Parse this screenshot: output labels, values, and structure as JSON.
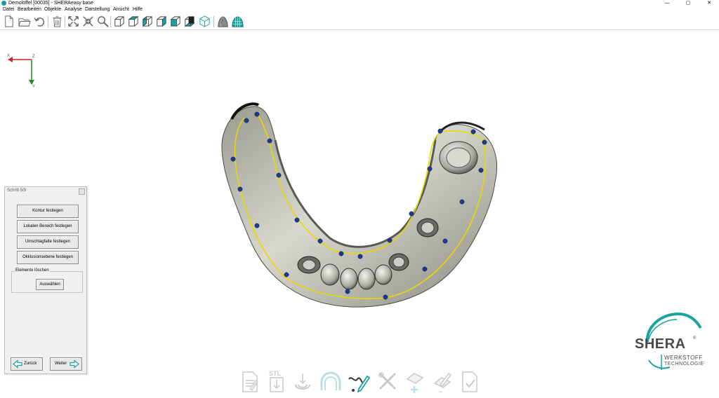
{
  "window": {
    "title": "Demolöffel [00035] - SHERAeasy base",
    "controls": [
      "—",
      "▢",
      "✕"
    ]
  },
  "menu": [
    "Datei",
    "Bearbeiten",
    "Objekte",
    "Analyse",
    "Darstellung",
    "Ansicht",
    "Hilfe"
  ],
  "toolbar": {
    "icons": [
      "new-file-icon",
      "open-folder-icon",
      "undo-icon",
      "delete-icon",
      "expand-arrows-icon",
      "collapse-arrows-icon",
      "zoom-icon",
      "view-cube-front-icon",
      "view-cube-top-icon",
      "view-cube-left-icon",
      "view-cube-right-icon",
      "view-cube-back-icon",
      "view-cube-bottom-icon",
      "view-cube-iso-icon",
      "shading-solid-icon",
      "shading-texture-icon"
    ]
  },
  "axes": {
    "x_label": "X",
    "z_label": "Z",
    "y_label": "Y"
  },
  "panel": {
    "title": "Schritt 5/9",
    "buttons": [
      "Kontur festlegen",
      "Lokalen Bereich festlegen",
      "Umschlagfalte festlegen",
      "Okklusionsebene festlegen"
    ],
    "group_label": "Elemente löschen",
    "select_label": "Auswählen",
    "back_label": "Zurück",
    "next_label": "Weiter"
  },
  "workflow": {
    "steps": [
      "document-step-icon",
      "stl-import-step-icon",
      "scan-align-step-icon",
      "arch-step-icon",
      "contour-draw-step-icon",
      "tools-step-icon",
      "add-element-step-icon",
      "edit-step-icon",
      "export-step-icon"
    ],
    "stl_text": "STL",
    "active_index": 4
  },
  "logo": {
    "brand": "SHERA",
    "registered": "®",
    "line1": "WERKSTOFF",
    "line2": "TECHNOLOGIE"
  },
  "colors": {
    "accent": "#1aa39f",
    "contour": "#e8d800",
    "points": "#1f3a8a",
    "axis_x": "#d62020",
    "axis_y": "#1a8a1a"
  }
}
